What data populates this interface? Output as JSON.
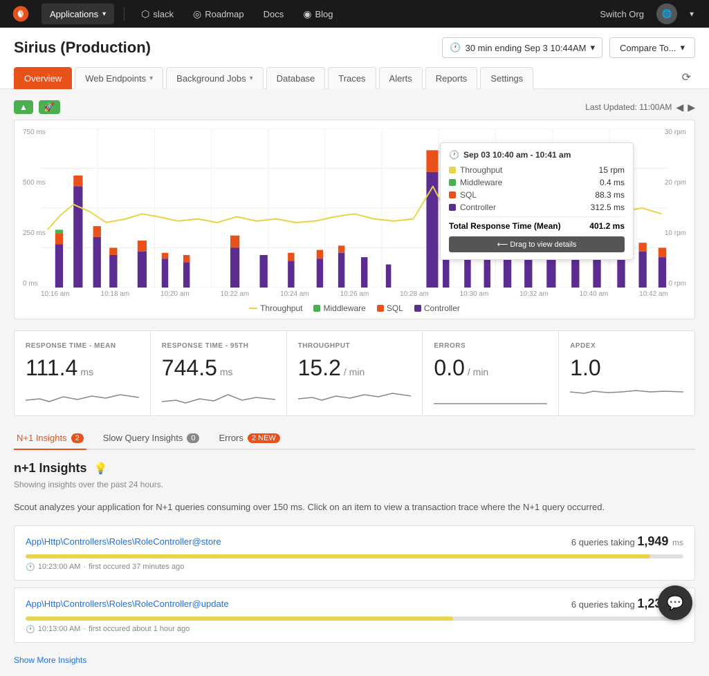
{
  "app": {
    "name": "Applications",
    "logo_alt": "scout-logo"
  },
  "top_nav": {
    "apps_label": "Applications",
    "slack_label": "slack",
    "roadmap_label": "Roadmap",
    "docs_label": "Docs",
    "blog_label": "Blog",
    "switch_org_label": "Switch Org",
    "chevron": "▾"
  },
  "page": {
    "title": "Sirius (Production)",
    "time_label": "30 min ending Sep 3 10:44AM",
    "compare_label": "Compare To...",
    "last_updated": "Last Updated: 11:00AM"
  },
  "tabs": [
    {
      "id": "overview",
      "label": "Overview",
      "active": true,
      "has_chevron": false
    },
    {
      "id": "web-endpoints",
      "label": "Web Endpoints",
      "active": false,
      "has_chevron": true
    },
    {
      "id": "background-jobs",
      "label": "Background Jobs",
      "active": false,
      "has_chevron": true
    },
    {
      "id": "database",
      "label": "Database",
      "active": false,
      "has_chevron": false
    },
    {
      "id": "traces",
      "label": "Traces",
      "active": false,
      "has_chevron": false
    },
    {
      "id": "alerts",
      "label": "Alerts",
      "active": false,
      "has_chevron": false
    },
    {
      "id": "reports",
      "label": "Reports",
      "active": false,
      "has_chevron": false
    },
    {
      "id": "settings",
      "label": "Settings",
      "active": false,
      "has_chevron": false
    }
  ],
  "chart": {
    "y_labels_left": [
      "750 ms",
      "500 ms",
      "250 ms",
      "0 ms"
    ],
    "y_labels_right": [
      "30 rpm",
      "20 rpm",
      "10 rpm",
      "0 rpm"
    ],
    "x_labels": [
      "10:16 am",
      "10:18 am",
      "10:20 am",
      "10:22 am",
      "10:24 am",
      "10:26 am",
      "10:28 am",
      "10:30 am",
      "10:32 am",
      "10:40 am",
      "10:42 am"
    ],
    "legend": {
      "throughput": "Throughput",
      "middleware": "Middleware",
      "sql": "SQL",
      "controller": "Controller"
    },
    "tooltip": {
      "title": "Sep 03 10:40 am - 10:41 am",
      "throughput_label": "Throughput",
      "throughput_val": "15 rpm",
      "middleware_label": "Middleware",
      "middleware_val": "0.4 ms",
      "sql_label": "SQL",
      "sql_val": "88.3 ms",
      "controller_label": "Controller",
      "controller_val": "312.5 ms",
      "total_label": "Total Response Time (Mean)",
      "total_val": "401.2 ms",
      "drag_label": "⟵ Drag to view details"
    }
  },
  "metrics": [
    {
      "id": "response-mean",
      "label": "RESPONSE TIME - MEAN",
      "value": "111.4",
      "unit": "ms"
    },
    {
      "id": "response-95th",
      "label": "RESPONSE TIME - 95TH",
      "value": "744.5",
      "unit": "ms"
    },
    {
      "id": "throughput",
      "label": "THROUGHPUT",
      "value": "15.2",
      "unit": "/ min"
    },
    {
      "id": "errors",
      "label": "ERRORS",
      "value": "0.0",
      "unit": "/ min"
    },
    {
      "id": "apdex",
      "label": "APDEX",
      "value": "1.0",
      "unit": ""
    }
  ],
  "insights_tabs": [
    {
      "id": "n1",
      "label": "N+1 Insights",
      "badge": "2",
      "badge_type": "orange",
      "active": true
    },
    {
      "id": "slow-query",
      "label": "Slow Query Insights",
      "badge": "0",
      "badge_type": "gray",
      "active": false
    },
    {
      "id": "errors",
      "label": "Errors",
      "badge": "2 NEW",
      "badge_type": "new",
      "active": false
    }
  ],
  "insights": {
    "title": "n+1 Insights",
    "subtitle": "Showing insights over the past 24 hours.",
    "description": "Scout analyzes your application for N+1 queries consuming over 150 ms. Click on an item to view a transaction trace where the N+1 query occurred.",
    "items": [
      {
        "id": "item1",
        "link": "App\\Http\\Controllers\\Roles\\RoleController@store",
        "queries": "6",
        "taking_label": "queries taking",
        "value": "1,949",
        "unit": "ms",
        "progress": 95,
        "time": "10:23:00 AM",
        "first_occurred": "first occured 37 minutes ago"
      },
      {
        "id": "item2",
        "link": "App\\Http\\Controllers\\Roles\\RoleController@update",
        "queries": "6",
        "taking_label": "queries taking",
        "value": "1,232",
        "unit": "ms",
        "progress": 65,
        "time": "10:13:00 AM",
        "first_occurred": "first occured about 1 hour ago"
      }
    ],
    "show_more_label": "Show More Insights"
  }
}
